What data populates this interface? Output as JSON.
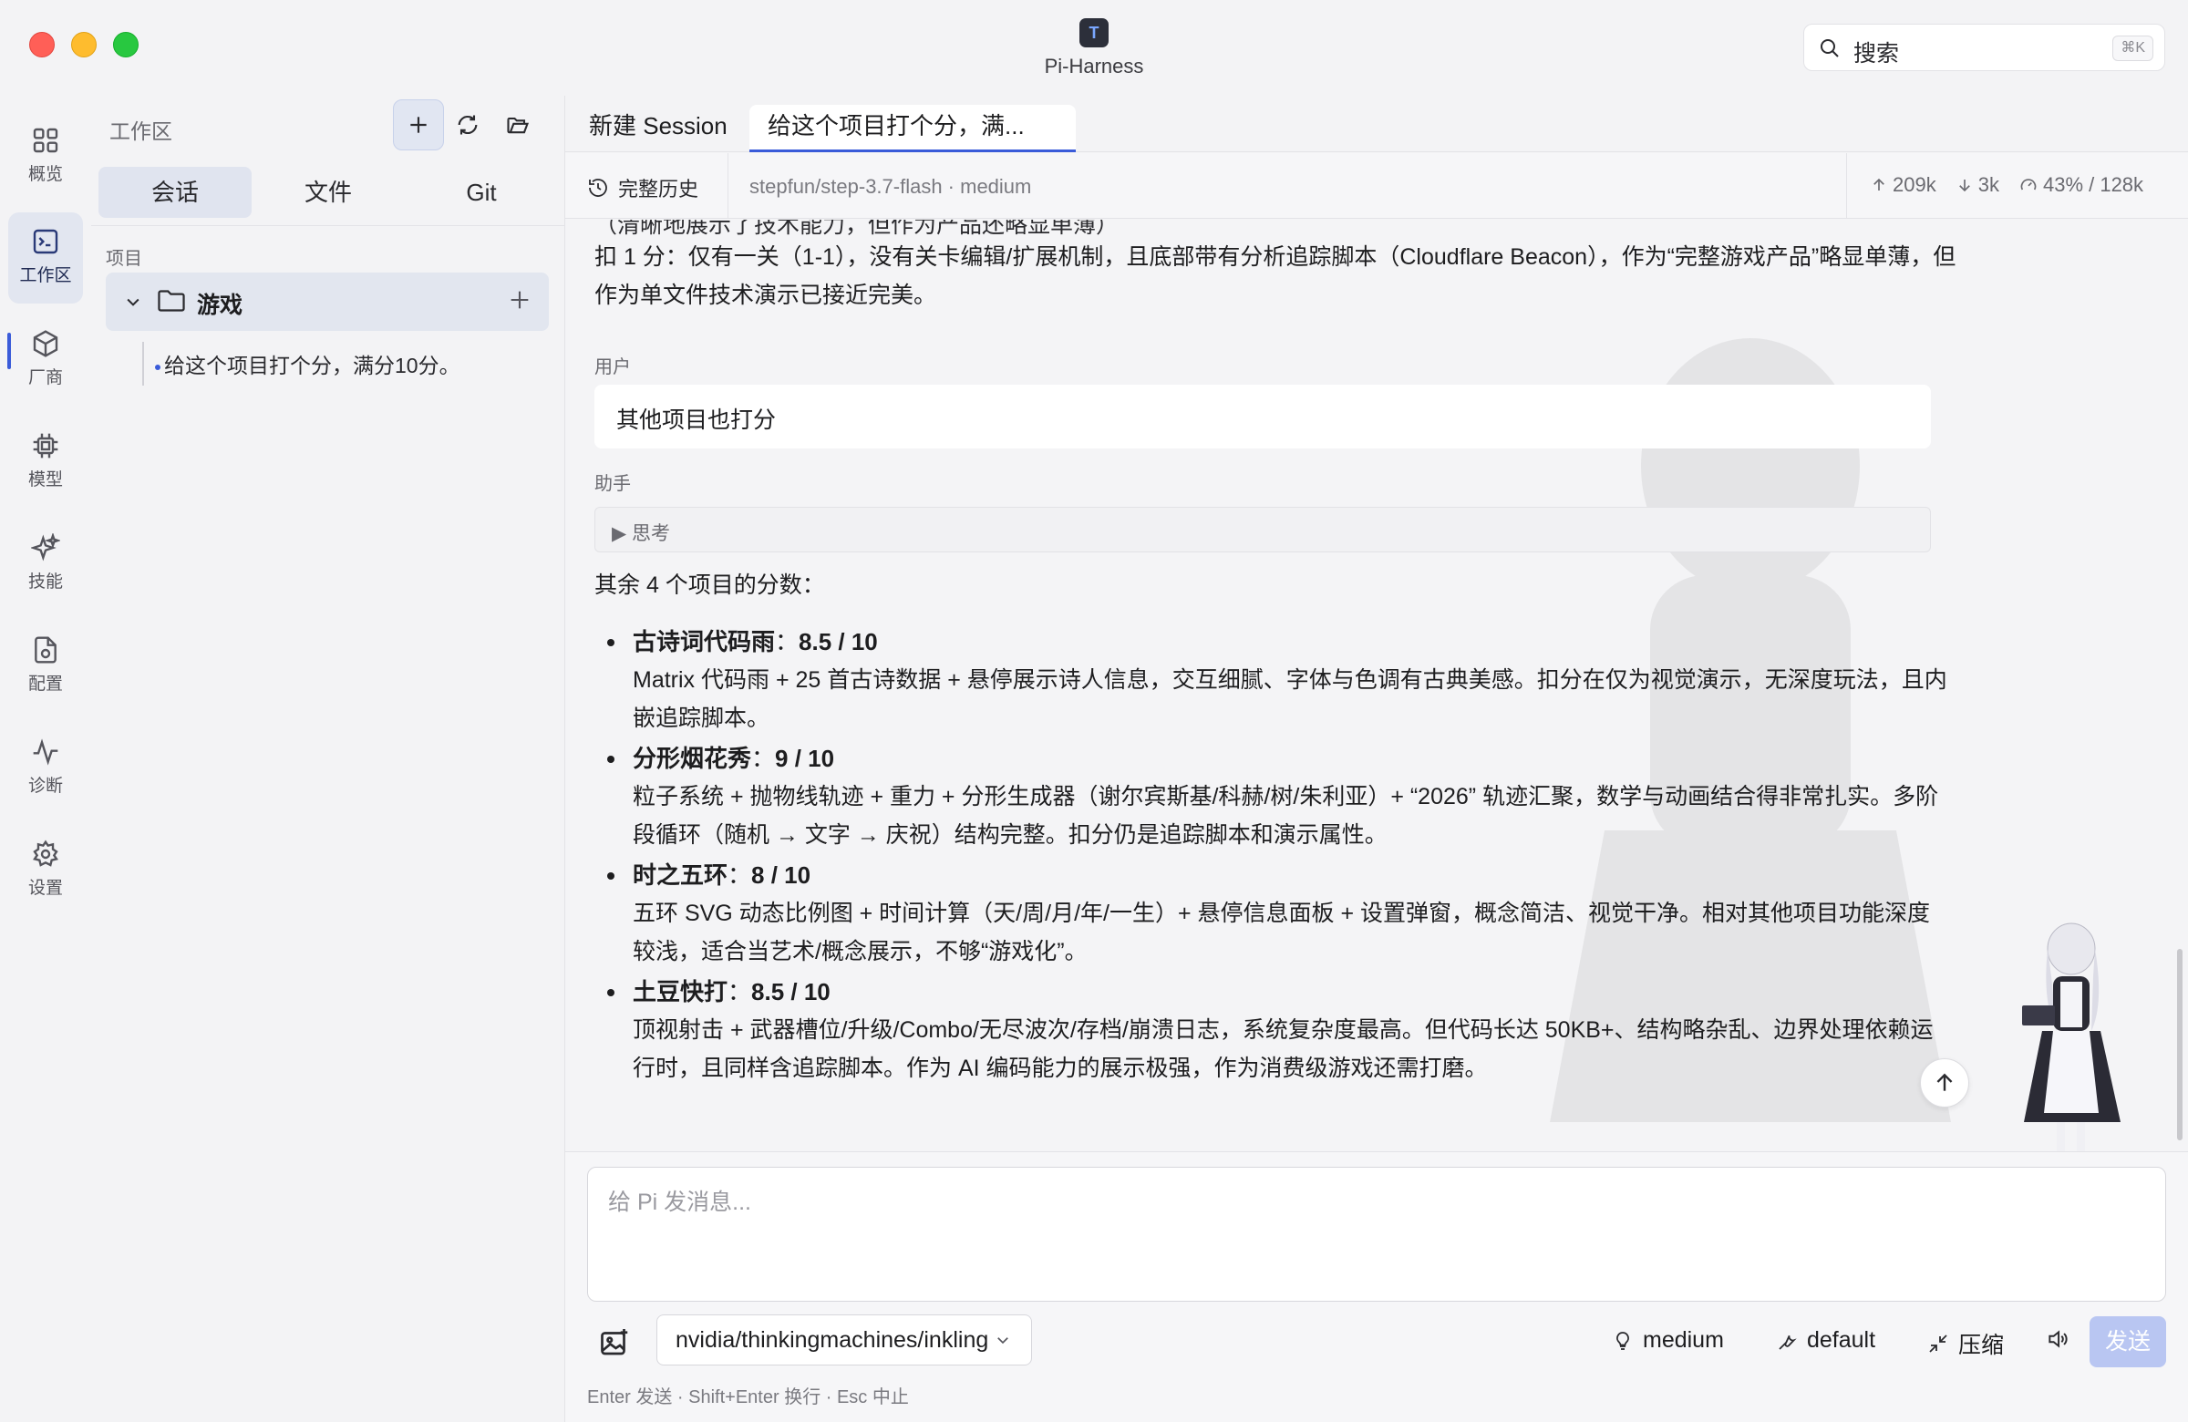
{
  "window": {
    "app_title": "Pi-Harness",
    "logo_glyph": "T"
  },
  "search": {
    "label": "搜索",
    "shortcut": "⌘K"
  },
  "rail": {
    "items": [
      {
        "label": "概览",
        "icon": "grid-icon"
      },
      {
        "label": "工作区",
        "icon": "terminal-icon",
        "active": true
      },
      {
        "label": "厂商",
        "icon": "cube-icon"
      },
      {
        "label": "模型",
        "icon": "chip-icon"
      },
      {
        "label": "技能",
        "icon": "sparkles-icon"
      },
      {
        "label": "配置",
        "icon": "file-settings-icon"
      },
      {
        "label": "诊断",
        "icon": "pulse-icon"
      },
      {
        "label": "设置",
        "icon": "gear-icon"
      }
    ]
  },
  "sidebar": {
    "header": "工作区",
    "segments": [
      "会话",
      "文件",
      "Git"
    ],
    "section_label": "项目",
    "project": {
      "name": "游戏"
    },
    "session": "给这个项目打个分，满分10分。"
  },
  "tabs": [
    "新建 Session",
    "给这个项目打个分，满..."
  ],
  "toolbar": {
    "history_label": "完整历史",
    "model_info": "stepfun/step-3.7-flash · medium",
    "stats": {
      "up": "209k",
      "down": "3k",
      "context": "43% / 128k"
    }
  },
  "chat": {
    "cut_line": "（清晰地展示了技术能力，但作为产品还略显单薄）",
    "deduction": "扣 1 分：仅有一关（1-1），没有关卡编辑/扩展机制，且底部带有分析追踪脚本（Cloudflare Beacon），作为“完整游戏产品”略显单薄，但作为单文件技术演示已接近完美。",
    "user_role": "用户",
    "user_message": "其他项目也打分",
    "assistant_role": "助手",
    "thinking_label": "▶ 思考",
    "intro": "其余 4 个项目的分数：",
    "scores": [
      {
        "name": "古诗词代码雨",
        "score": "8.5 / 10",
        "desc": "Matrix 代码雨 + 25 首古诗数据 + 悬停展示诗人信息，交互细腻、字体与色调有古典美感。扣分在仅为视觉演示，无深度玩法，且内嵌追踪脚本。"
      },
      {
        "name": "分形烟花秀",
        "score": "9 / 10",
        "desc": "粒子系统 + 抛物线轨迹 + 重力 + 分形生成器（谢尔宾斯基/科赫/树/朱利亚）+ “2026” 轨迹汇聚，数学与动画结合得非常扎实。多阶段循环（随机 → 文字 → 庆祝）结构完整。扣分仍是追踪脚本和演示属性。"
      },
      {
        "name": "时之五环",
        "score": "8 / 10",
        "desc": "五环 SVG 动态比例图 + 时间计算（天/周/月/年/一生）+ 悬停信息面板 + 设置弹窗，概念简洁、视觉干净。相对其他项目功能深度较浅，适合当艺术/概念展示，不够“游戏化”。"
      },
      {
        "name": "土豆快打",
        "score": "8.5 / 10",
        "desc": "顶视射击 + 武器槽位/升级/Combo/无尽波次/存档/崩溃日志，系统复杂度最高。但代码长达 50KB+、结构略杂乱、边界处理依赖运行时，且同样含追踪脚本。作为 AI 编码能力的展示极强，作为消费级游戏还需打磨。"
      }
    ]
  },
  "composer": {
    "placeholder": "给 Pi 发消息...",
    "model": "nvidia/thinkingmachines/inkling",
    "effort": "medium",
    "tools": "default",
    "compress": "压缩",
    "send": "发送",
    "hint": "Enter 发送 · Shift+Enter 换行 · Esc 中止"
  },
  "colors": {
    "accent": "#3a5bd9",
    "send_disabled": "#b9c6f2",
    "close": "#ff5f57",
    "minimize": "#febc2e",
    "maximize": "#28c840"
  }
}
